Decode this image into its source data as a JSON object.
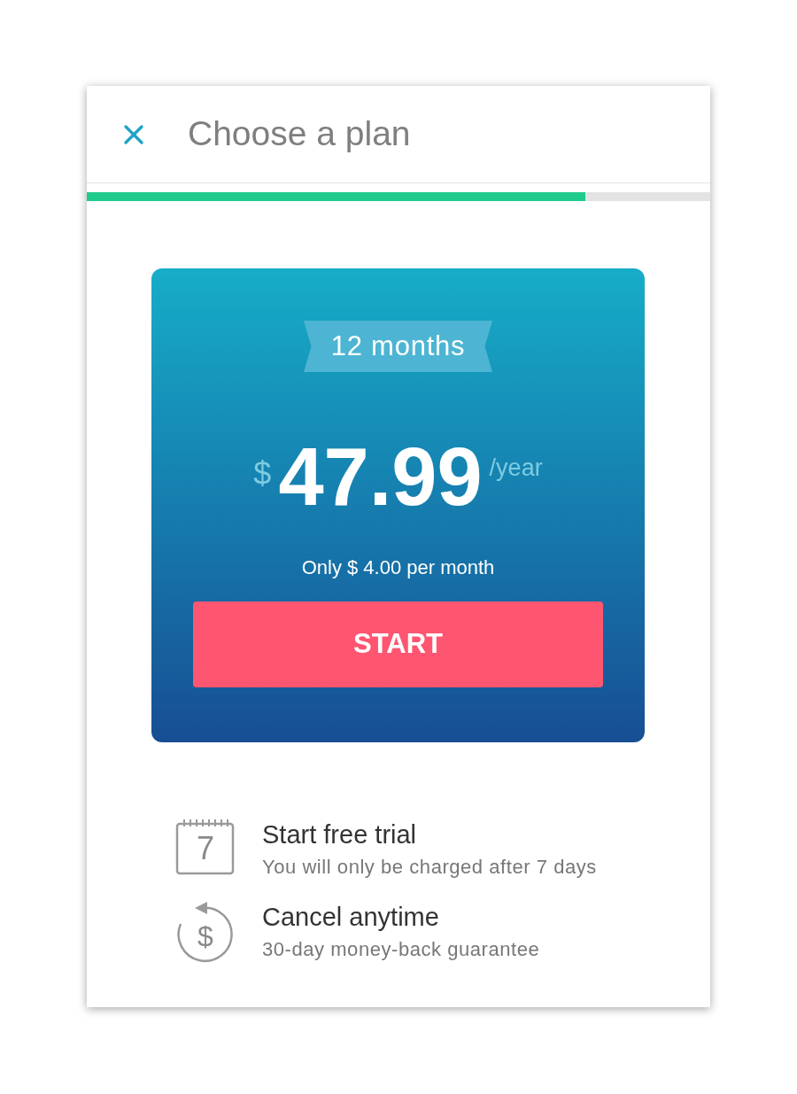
{
  "header": {
    "title": "Choose a plan"
  },
  "progress": {
    "level": 0.8
  },
  "plan": {
    "period": "12 months",
    "currency": "$",
    "price": "47.99",
    "unit": "/year",
    "note": "Only $ 4.00 per month",
    "button": "START"
  },
  "features": [
    {
      "kind": "calendar",
      "icon_text": "7",
      "title": "Start free trial",
      "subtitle": "You will only be charged after 7 days"
    },
    {
      "kind": "refund",
      "icon_text": "$",
      "title": "Cancel anytime",
      "subtitle": "30-day money-back guarantee"
    }
  ]
}
